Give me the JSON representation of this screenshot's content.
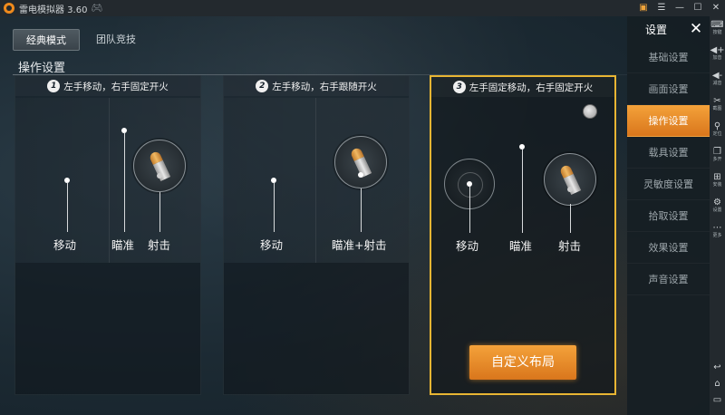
{
  "titlebar": {
    "title": "雷电模拟器 3.60",
    "icons": [
      "app-logo",
      "gamepad-icon",
      "gift-icon",
      "menu-icon",
      "minimize-icon",
      "maximize-icon",
      "close-icon"
    ]
  },
  "tabs": [
    {
      "label": "经典模式",
      "active": true
    },
    {
      "label": "团队竞技",
      "active": false
    }
  ],
  "section_title": "操作设置",
  "cards": [
    {
      "number": "1",
      "title": "左手移动，右手固定开火",
      "labels": {
        "move": "移动",
        "aim": "瞄准",
        "fire": "射击"
      },
      "selected": false
    },
    {
      "number": "2",
      "title": "左手移动，右手跟随开火",
      "labels": {
        "move": "移动",
        "aim_fire": "瞄准+射击"
      },
      "selected": false
    },
    {
      "number": "3",
      "title": "左手固定移动，右手固定开火",
      "labels": {
        "move": "移动",
        "aim": "瞄准",
        "fire": "射击"
      },
      "selected": true,
      "custom_button": "自定义布局"
    }
  ],
  "settings": {
    "title": "设置",
    "items": [
      {
        "label": "基础设置",
        "active": false
      },
      {
        "label": "画面设置",
        "active": false
      },
      {
        "label": "操作设置",
        "active": true
      },
      {
        "label": "载具设置",
        "active": false
      },
      {
        "label": "灵敏度设置",
        "active": false
      },
      {
        "label": "拾取设置",
        "active": false
      },
      {
        "label": "效果设置",
        "active": false
      },
      {
        "label": "声音设置",
        "active": false
      }
    ]
  },
  "toolbar": {
    "items": [
      {
        "icon": "keyboard-icon",
        "label": "按键"
      },
      {
        "icon": "volume-up-icon",
        "label": "加音"
      },
      {
        "icon": "volume-down-icon",
        "label": "减音"
      },
      {
        "icon": "scissors-icon",
        "label": "截图"
      },
      {
        "icon": "location-icon",
        "label": "定位"
      },
      {
        "icon": "multi-window-icon",
        "label": "多开"
      },
      {
        "icon": "install-icon",
        "label": "安装"
      },
      {
        "icon": "gear-icon",
        "label": "设置"
      },
      {
        "icon": "more-icon",
        "label": "更多"
      }
    ],
    "nav": [
      "back-icon",
      "home-icon",
      "recent-apps-icon"
    ]
  },
  "colors": {
    "accent": "#f4a23a",
    "selected_border": "#e8b533"
  }
}
